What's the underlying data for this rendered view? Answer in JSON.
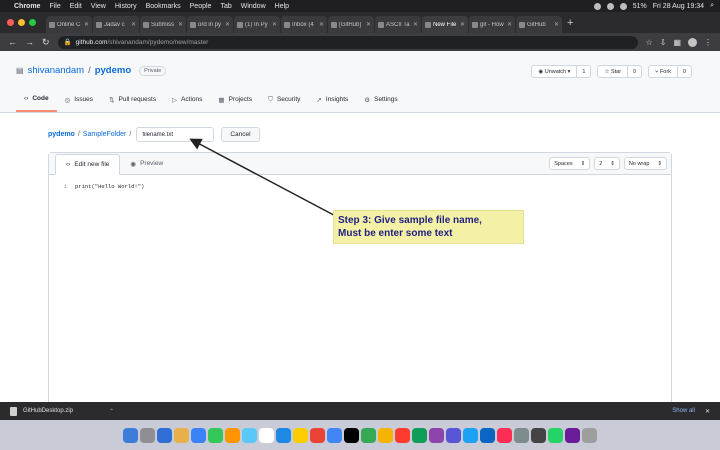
{
  "menubar": {
    "app": "Chrome",
    "items": [
      "File",
      "Edit",
      "View",
      "History",
      "Bookmarks",
      "People",
      "Tab",
      "Window",
      "Help"
    ],
    "battery": "51%",
    "clock": "Fri 28 Aug 19:34"
  },
  "tabs": [
    {
      "label": "Online C",
      "active": false
    },
    {
      "label": "Jadav c",
      "active": false
    },
    {
      "label": "Submiss",
      "active": false
    },
    {
      "label": "ord in py",
      "active": false
    },
    {
      "label": "(1) In Py",
      "active": false
    },
    {
      "label": "Inbox (4",
      "active": false
    },
    {
      "label": "[GitHub]",
      "active": false
    },
    {
      "label": "ASCII Ta",
      "active": false
    },
    {
      "label": "New File",
      "active": true
    },
    {
      "label": "git - How",
      "active": false
    },
    {
      "label": "GitHub",
      "active": false
    }
  ],
  "address": {
    "host": "github.com",
    "path": "/shivanandam/pydemo/new/master"
  },
  "repo": {
    "owner": "shivanandam",
    "name": "pydemo",
    "visibility": "Private",
    "unwatch_label": "Unwatch",
    "unwatch_count": "1",
    "star_label": "Star",
    "star_count": "0",
    "fork_label": "Fork",
    "fork_count": "0"
  },
  "repo_nav": [
    {
      "label": "Code",
      "icon": "code-icon",
      "active": true
    },
    {
      "label": "Issues",
      "icon": "issue-icon",
      "active": false
    },
    {
      "label": "Pull requests",
      "icon": "pull-request-icon",
      "active": false
    },
    {
      "label": "Actions",
      "icon": "play-icon",
      "active": false
    },
    {
      "label": "Projects",
      "icon": "project-icon",
      "active": false
    },
    {
      "label": "Security",
      "icon": "shield-icon",
      "active": false
    },
    {
      "label": "Insights",
      "icon": "graph-icon",
      "active": false
    },
    {
      "label": "Settings",
      "icon": "gear-icon",
      "active": false
    }
  ],
  "path": {
    "repo": "pydemo",
    "folder": "SampleFolder",
    "filename_value": "filename.txt",
    "cancel_label": "Cancel"
  },
  "editor": {
    "edit_tab": "Edit new file",
    "preview_tab": "Preview",
    "indent_mode": "Spaces",
    "indent_size": "2",
    "wrap_mode": "No wrap",
    "lines": [
      {
        "num": "1",
        "code": "print(\"Hello World!\")"
      }
    ]
  },
  "annotation": {
    "line1": "Step 3: Give sample file name,",
    "line2": "Must be enter some text"
  },
  "downloads": {
    "file": "GitHubDesktop.zip",
    "show_all": "Show all"
  },
  "colors": {
    "accent": "#0969da",
    "active_tab_underline": "#fd8c73",
    "annotation_bg": "#f4f1a6",
    "annotation_text": "#1f1f80"
  }
}
